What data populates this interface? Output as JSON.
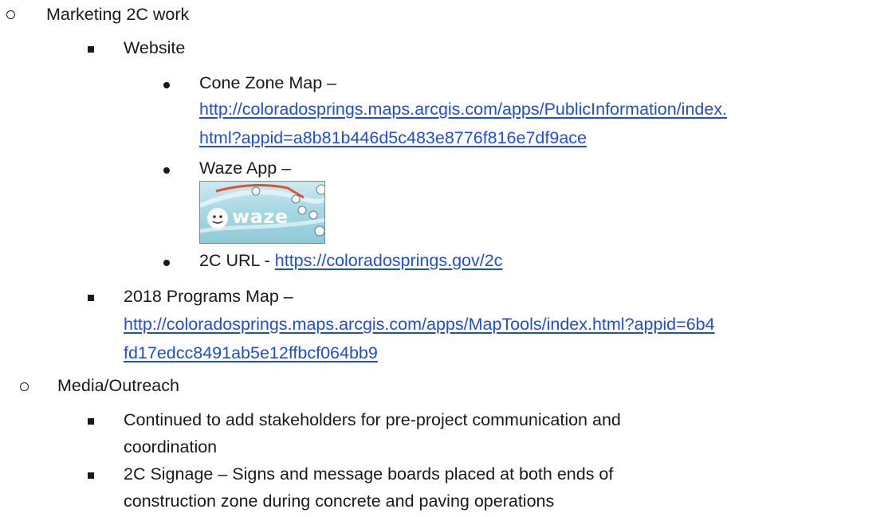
{
  "items": {
    "marketing": "Marketing 2C work",
    "website": "Website",
    "cone_zone_label": "Cone Zone Map –",
    "cone_zone_url_line1": "http://coloradosprings.maps.arcgis.com/apps/PublicInformation/index.",
    "cone_zone_url_line2": "html?appid=a8b81b446d5c483e8776f816e7df9ace",
    "waze_label": "Waze App –",
    "waze_logo_text": "waze",
    "url_label": "2C URL - ",
    "url_link": "https://coloradosprings.gov/2c",
    "programs_label": "2018 Programs Map –",
    "programs_url_line1": "http://coloradosprings.maps.arcgis.com/apps/MapTools/index.html?appid=6b4",
    "programs_url_line2": "fd17edcc8491ab5e12ffbcf064bb9",
    "media": "Media/Outreach",
    "stakeholders_line1": "Continued to add stakeholders for pre-project communication and",
    "stakeholders_line2": "coordination",
    "signage_line1": "2C Signage – Signs and message boards placed at both ends of",
    "signage_line2": "construction zone during concrete and paving operations"
  },
  "colors": {
    "text": "#1a1a1a",
    "link": "#1f4fd6"
  }
}
